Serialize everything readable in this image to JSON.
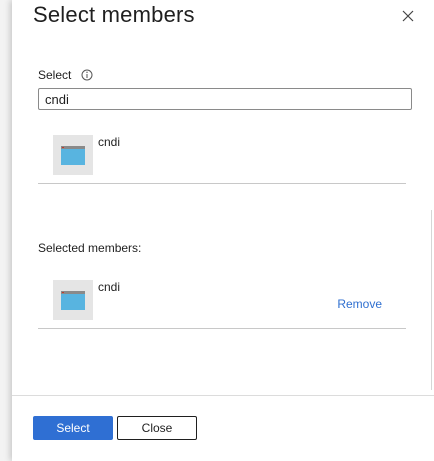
{
  "dialog": {
    "title": "Select members",
    "close_icon": "close-icon"
  },
  "search": {
    "label": "Select",
    "info_icon": "info-icon",
    "value": "cndi"
  },
  "results": [
    {
      "name": "cndi",
      "icon": "app-icon"
    }
  ],
  "selected": {
    "label": "Selected members:",
    "items": [
      {
        "name": "cndi",
        "icon": "app-icon",
        "remove_label": "Remove"
      }
    ]
  },
  "footer": {
    "select_label": "Select",
    "close_label": "Close"
  },
  "colors": {
    "accent": "#2f6fd3",
    "link": "#2f6fd0",
    "app_icon_blue": "#58b4e0"
  }
}
